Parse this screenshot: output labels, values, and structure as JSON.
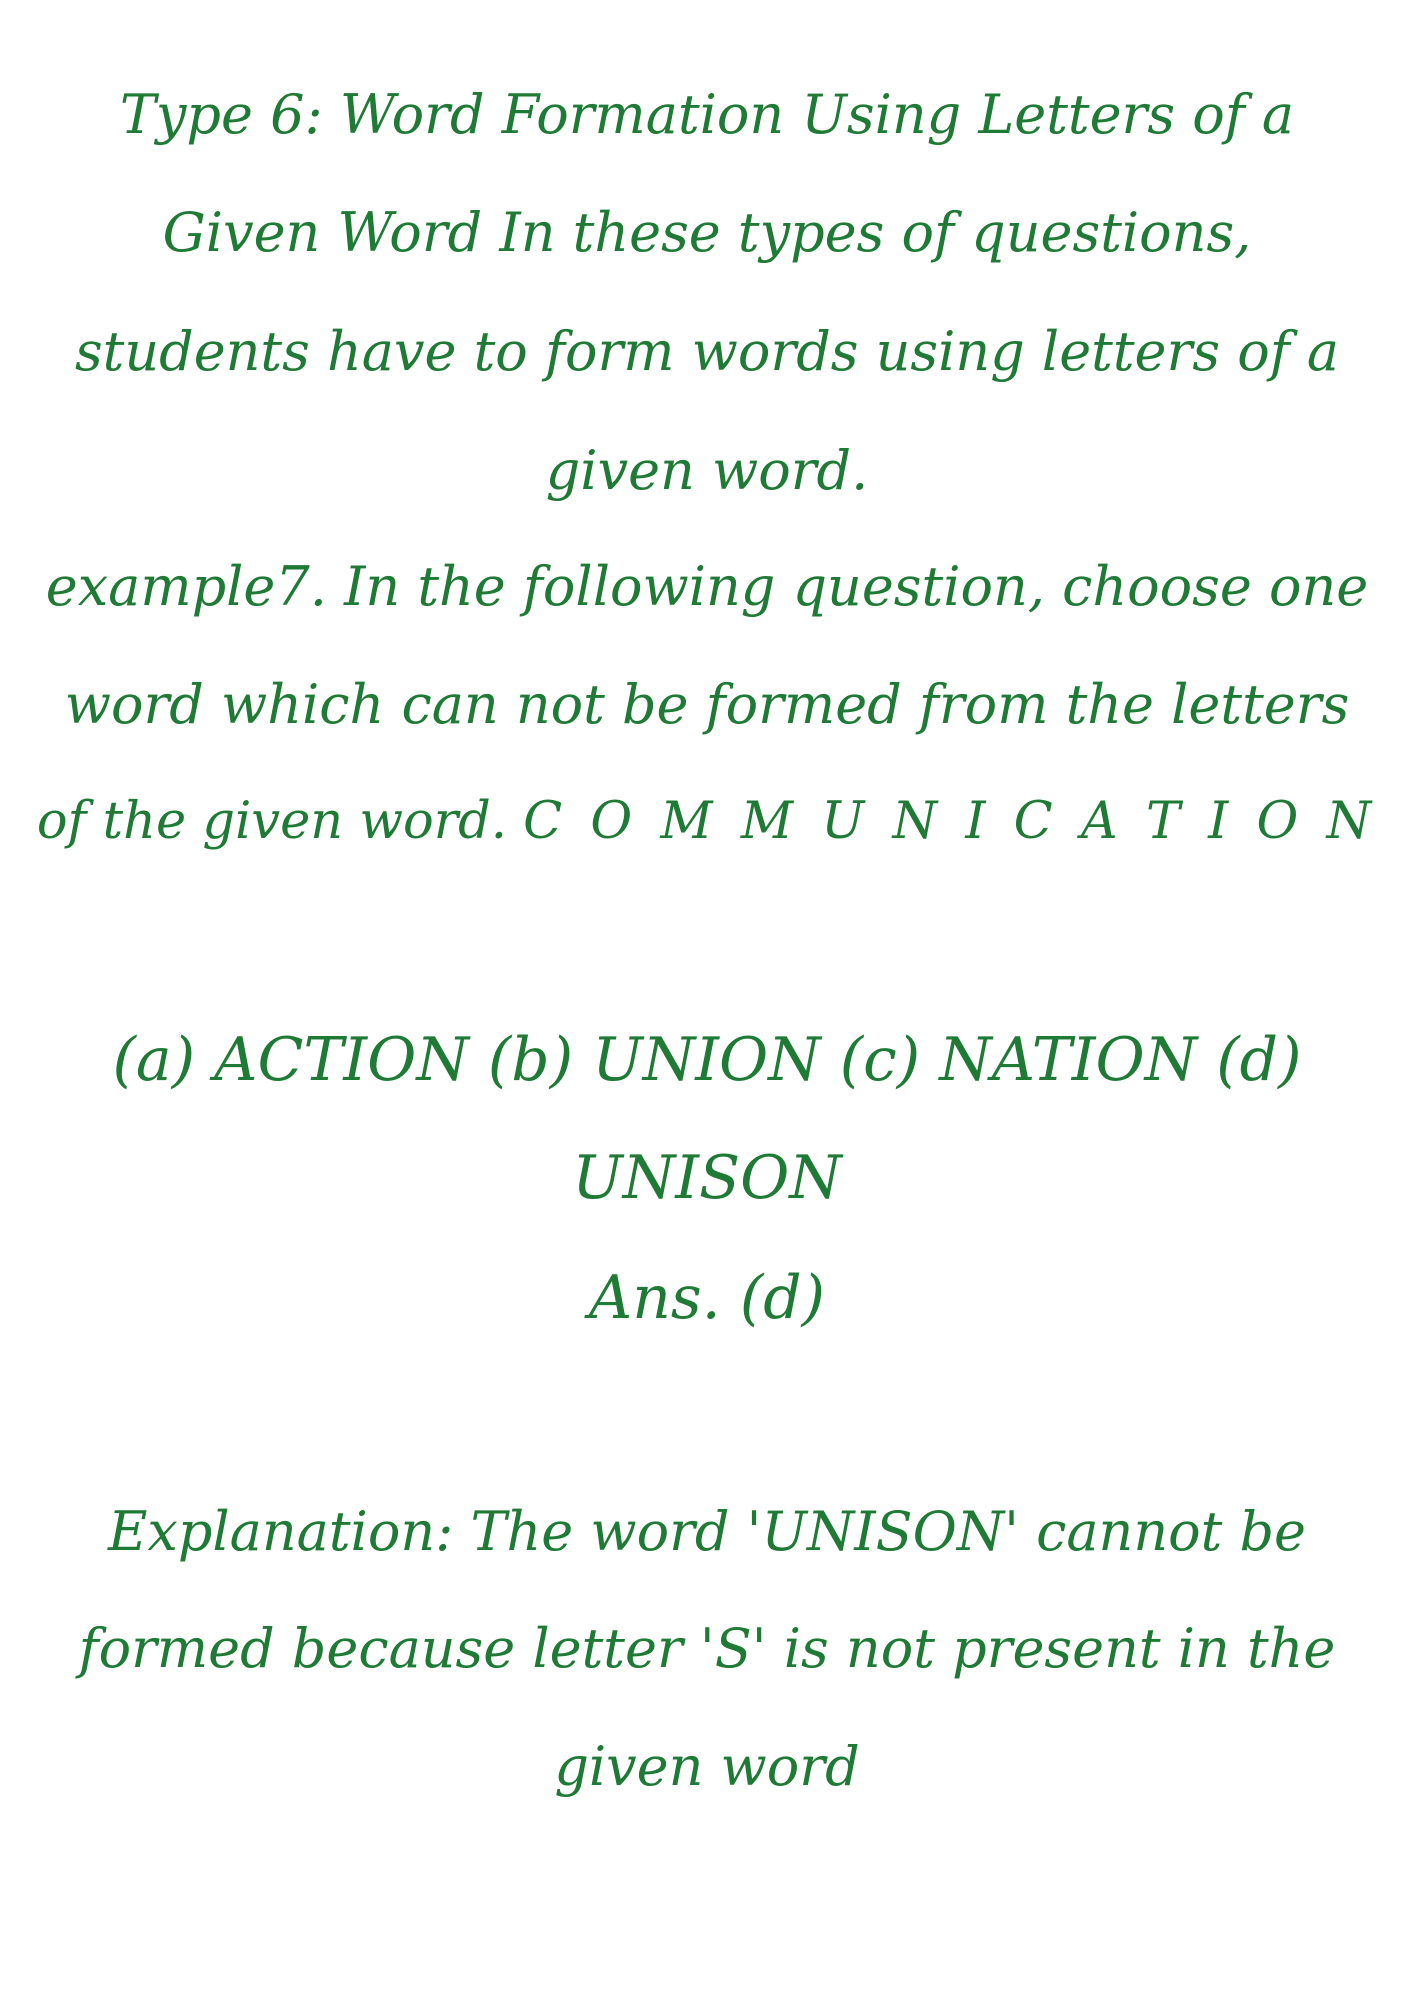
{
  "content": {
    "lines": [
      "Type 6: Word Formation Using Letters of a",
      "Given Word In these types of questions,",
      "students have to form words using letters of a",
      "given word.",
      "example7. In the following question, choose one",
      "word which can not be formed from the letters",
      "of the given word."
    ],
    "given_word": "C O M M U N I C A T I O N",
    "options_line_1": "(a) ACTION (b) UNION (c) NATION (d)",
    "options_line_2": "UNISON",
    "answer": "Ans. (d)",
    "explanation_lines": [
      "Explanation: The word 'UNISON' cannot be",
      "formed because letter 'S' is not present in the",
      "given word"
    ]
  },
  "colors": {
    "text": "#1f7a35",
    "background": "#ffffff"
  }
}
